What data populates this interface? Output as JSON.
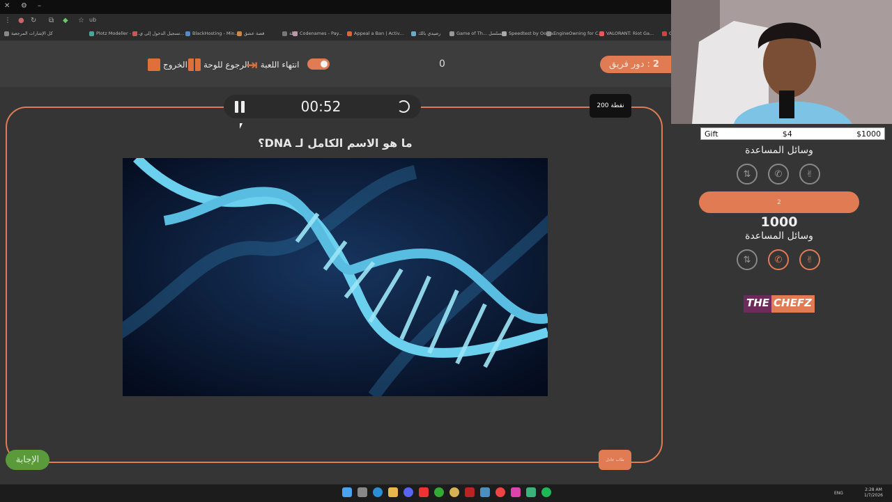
{
  "colors": {
    "accent": "#e07b54",
    "answer": "#5a9a3a",
    "logo_purple": "#6d2a5a"
  },
  "browser": {
    "titlebar_icons": [
      "close-x",
      "settings",
      "minimize"
    ],
    "toolbar_url": "ub",
    "bookmarks": [
      "كل الإشارات المرجعية",
      "Plotz Modeller - Mi...",
      "تسجيل الدخول إلى ي...",
      "BlackHosting - Min...",
      "قصة عشق",
      "كملة",
      "Codenames - Pay...",
      "Appeal a Ban | Activ...",
      "رصيدي بالك",
      "Game of Th... مسلسل",
      "Speedtest by Ookla...",
      "EngineOwning for C...",
      "VALORANT: Riot Ga...",
      "Geo"
    ]
  },
  "header": {
    "exit_label": "الخروج",
    "back_label": "الرجوع للوحة",
    "end_game_label": "انتهاء اللعبة",
    "score": "0",
    "turn_label": "دور فريق :",
    "turn_number": "2"
  },
  "question": {
    "timer": "00:52",
    "points": "200 نقطة",
    "text": "ما هو الاسم الكامل لـ DNA؟",
    "answer_button": "الإجابة",
    "team_button": "طاب عادل"
  },
  "overlay": {
    "gift_label": "Gift",
    "gift_mid": "$4",
    "gift_total": "$1000"
  },
  "right_panel": {
    "help_title_1": "وسائل المساعدة",
    "team_name": "2",
    "team_score": "1000",
    "help_title_2": "وسائل المساعدة",
    "lifeline_icons": [
      "swap-icon",
      "phone-icon",
      "peace-hand-icon"
    ],
    "logo_part1": "THE",
    "logo_part2": "CHEFZ"
  },
  "taskbar": {
    "lang": "ENG",
    "time": "2:28 AM",
    "date": "1/7/2026"
  }
}
